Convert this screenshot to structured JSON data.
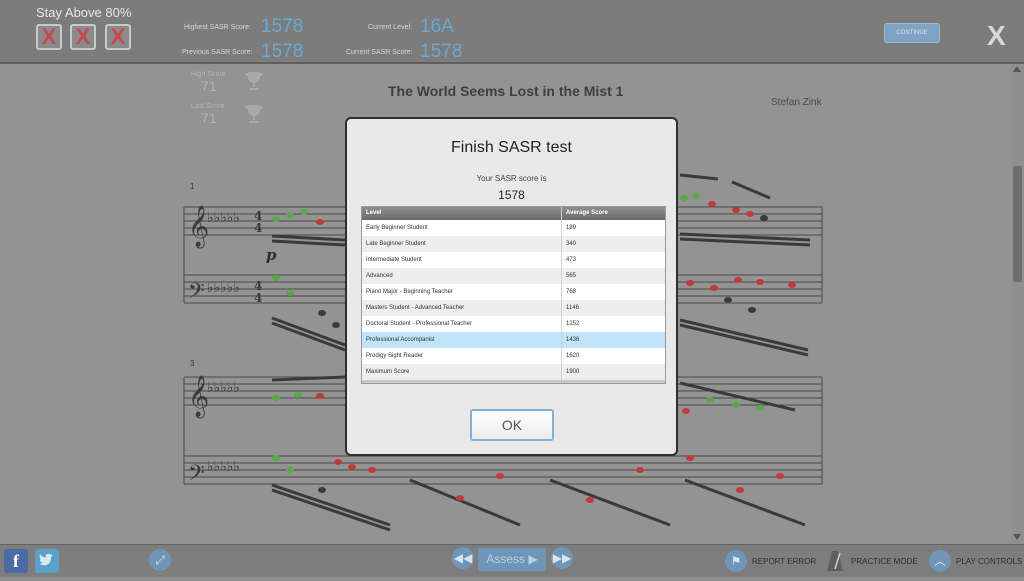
{
  "header": {
    "stay_title": "Stay Above 80%",
    "strikes": [
      "X",
      "X",
      "X"
    ],
    "highest_label": "Highest SASR Score:",
    "highest_value": "1578",
    "previous_label": "Previous SASR Score:",
    "previous_value": "1578",
    "level_label": "Current Level:",
    "level_value": "16A",
    "current_label": "Current SASR Score:",
    "current_value": "1578",
    "continue_label": "CONTINUE",
    "close_label": "X"
  },
  "score_panel": {
    "high_label": "High Score",
    "high_value": "71",
    "last_label": "Last Score",
    "last_value": "71"
  },
  "music": {
    "title": "The World Seems Lost in the Mist 1",
    "composer": "Stefan Zink",
    "measure_1": "1",
    "measure_3": "3",
    "dynamic": "p"
  },
  "modal": {
    "title": "Finish SASR test",
    "subtitle": "Your SASR score is",
    "score": "1578",
    "col_level": "Level",
    "col_average": "Average Score",
    "rows": [
      {
        "level": "Early Beginner Student",
        "score": "189"
      },
      {
        "level": "Late Beginner Student",
        "score": "340"
      },
      {
        "level": "Intermediate Student",
        "score": "473"
      },
      {
        "level": "Advanced",
        "score": "565"
      },
      {
        "level": "Piano Major - Beginning Teacher",
        "score": "768"
      },
      {
        "level": "Masters Student - Advanced Teacher",
        "score": "1146"
      },
      {
        "level": "Doctoral Student - Professional Teacher",
        "score": "1252"
      },
      {
        "level": "Professional Accompanist",
        "score": "1436"
      },
      {
        "level": "Prodigy Sight Reader",
        "score": "1620"
      },
      {
        "level": "Maximum Score",
        "score": "1900"
      }
    ],
    "highlighted_row": "Professional Accompanist",
    "ok_label": "OK"
  },
  "footer": {
    "facebook": "f",
    "assess_label": "Assess ▶",
    "report_error": "REPORT ERROR",
    "practice_mode": "PRACTICE MODE",
    "play_controls": "PLAY CONTROLS"
  },
  "colors": {
    "accent_blue": "#6aa8d4",
    "highlight_row": "#bfe4f7",
    "note_red": "#c03a3a",
    "note_green": "#5aa84a"
  }
}
